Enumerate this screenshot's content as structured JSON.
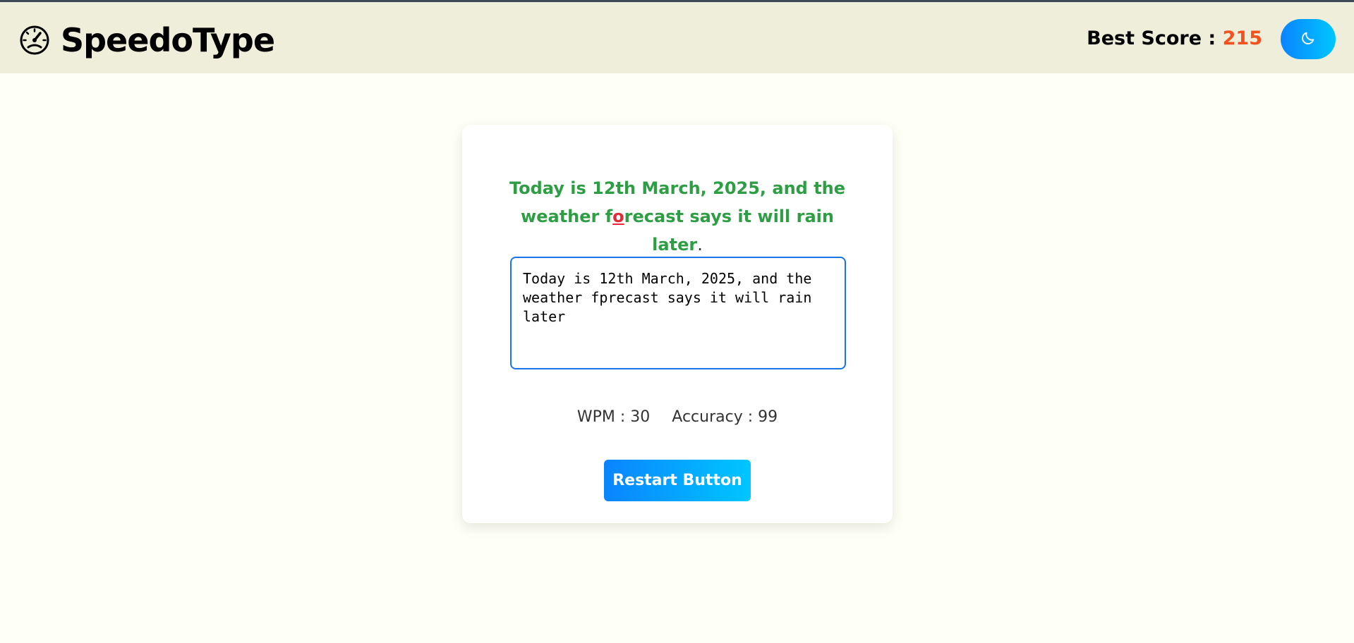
{
  "app": {
    "name": "SpeedoType",
    "logo_icon": "speedometer-icon"
  },
  "header": {
    "best_score_label": "Best Score : ",
    "best_score_value": "215",
    "theme_toggle_icon": "moon-icon"
  },
  "passage": {
    "correct_before": "Today is 12th March, 2025, and the weather f",
    "incorrect_char": "o",
    "correct_after": "recast says it will rain later",
    "pending": "."
  },
  "input": {
    "value": "Today is 12th March, 2025, and the weather fprecast says it will rain later"
  },
  "stats": {
    "wpm_text": "WPM : 30",
    "accuracy_text": "Accuracy : 99"
  },
  "restart_label": "Restart Button",
  "colors": {
    "header_bg": "#efeedb",
    "page_bg": "#fefff5",
    "correct": "#2e9e44",
    "incorrect": "#e52939",
    "score": "#f4511e",
    "accent_start": "#0a84ff",
    "accent_end": "#00c6ff"
  }
}
